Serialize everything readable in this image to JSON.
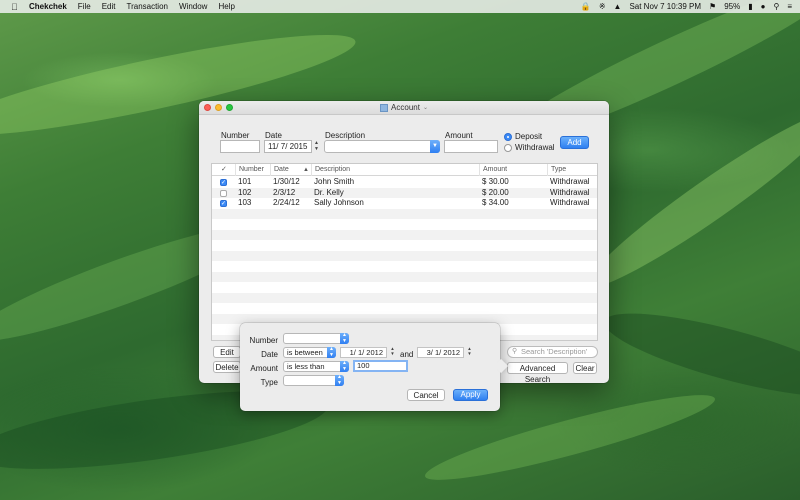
{
  "menubar": {
    "app": "Chekchek",
    "items": [
      "File",
      "Edit",
      "Transaction",
      "Window",
      "Help"
    ],
    "clock": "Sat Nov 7  10:39 PM",
    "battery": "95%"
  },
  "window": {
    "title": "Account",
    "form": {
      "number_label": "Number",
      "date_label": "Date",
      "date_value": "11/  7/ 2015",
      "description_label": "Description",
      "amount_label": "Amount",
      "deposit_label": "Deposit",
      "withdrawal_label": "Withdrawal",
      "add_label": "Add"
    },
    "table": {
      "headers": [
        "✓",
        "Number",
        "Date",
        "Description",
        "Amount",
        "Type"
      ],
      "rows": [
        {
          "checked": true,
          "number": "101",
          "date": "1/30/12",
          "description": "John Smith",
          "amount": "$ 30.00",
          "type": "Withdrawal"
        },
        {
          "checked": false,
          "number": "102",
          "date": "2/3/12",
          "description": "Dr. Kelly",
          "amount": "$ 20.00",
          "type": "Withdrawal"
        },
        {
          "checked": true,
          "number": "103",
          "date": "2/24/12",
          "description": "Sally Johnson",
          "amount": "$ 34.00",
          "type": "Withdrawal"
        }
      ]
    },
    "bottom": {
      "edit_label": "Edit",
      "delete_label": "Delete",
      "search_placeholder": "Search 'Description'",
      "advanced_label": "Advanced Search",
      "clear_label": "Clear"
    }
  },
  "popover": {
    "number_label": "Number",
    "date_label": "Date",
    "date_op": "is between",
    "date_from": "1/  1/ 2012",
    "and_label": "and",
    "date_to": "3/  1/ 2012",
    "amount_label": "Amount",
    "amount_op": "is less than",
    "amount_value": "100",
    "type_label": "Type",
    "cancel_label": "Cancel",
    "apply_label": "Apply"
  }
}
